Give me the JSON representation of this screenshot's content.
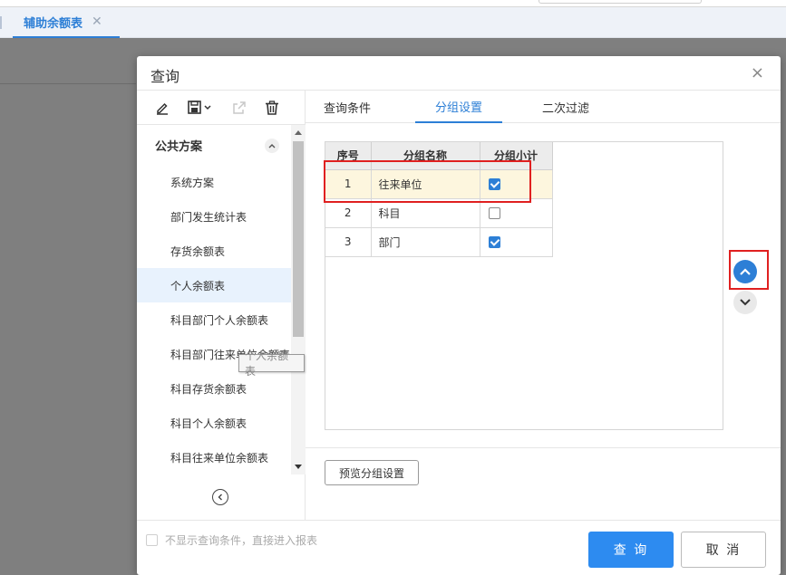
{
  "app": {
    "tab_title": "辅助余额表",
    "tab_close": "✕"
  },
  "dialog": {
    "title": "查询",
    "close": "×"
  },
  "left": {
    "group_label": "公共方案",
    "items": [
      "系统方案",
      "部门发生统计表",
      "存货余额表",
      "个人余额表",
      "科目部门个人余额表",
      "科目部门往来单位余额表",
      "科目存货余额表",
      "科目个人余额表",
      "科目往来单位余额表"
    ],
    "active_index": 3,
    "tooltip": "个人余额表"
  },
  "tabs": [
    "查询条件",
    "分组设置",
    "二次过滤"
  ],
  "active_tab": 1,
  "grid": {
    "headers": [
      "序号",
      "分组名称",
      "分组小计"
    ],
    "rows": [
      {
        "no": "1",
        "name": "往来单位",
        "subtotal": true
      },
      {
        "no": "2",
        "name": "科目",
        "subtotal": false
      },
      {
        "no": "3",
        "name": "部门",
        "subtotal": true
      }
    ],
    "selected_row": 0
  },
  "preview_button": "预览分组设置",
  "footer": {
    "skip_label": "不显示查询条件，直接进入报表",
    "query_button": "查 询",
    "cancel_button": "取 消"
  },
  "colors": {
    "accent": "#2d7fd6",
    "highlight_box": "#e02020",
    "selected_row": "#fdf6de"
  }
}
